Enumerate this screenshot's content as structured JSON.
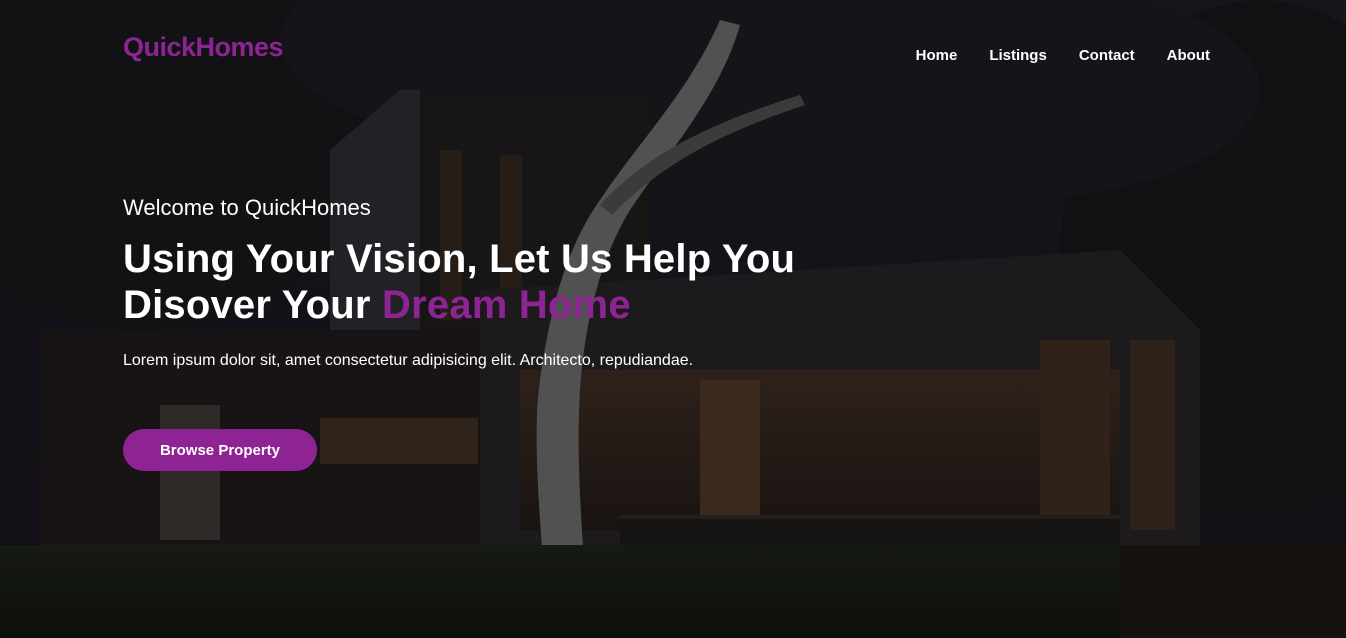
{
  "colors": {
    "accent": "#8e2494",
    "text": "#ffffff",
    "background": "#15141a"
  },
  "brand": {
    "name": "QuickHomes"
  },
  "nav": {
    "items": [
      "Home",
      "Listings",
      "Contact",
      "About"
    ]
  },
  "hero": {
    "welcome": "Welcome to QuickHomes",
    "headline_line1": "Using Your Vision, Let Us Help You",
    "headline_line2_prefix": "Disover Your",
    "headline_highlight": "Dream Home",
    "subtitle": "Lorem ipsum dolor sit, amet consectetur adipisicing elit. Architecto, repudiandae.",
    "cta_label": "Browse Property",
    "background_image": "night-modern-house-photo"
  }
}
